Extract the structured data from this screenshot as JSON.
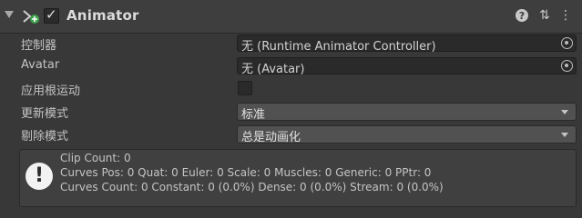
{
  "component": {
    "title": "Animator",
    "enabled_check": "✓",
    "help_glyph": "?",
    "presets_glyph": "⇅",
    "menu_glyph": "⋮"
  },
  "fields": {
    "controller": {
      "label": "控制器",
      "value": "无 (Runtime Animator Controller)"
    },
    "avatar": {
      "label": "Avatar",
      "value": "无 (Avatar)"
    },
    "apply_root_motion": {
      "label": "应用根运动",
      "checked": false
    },
    "update_mode": {
      "label": "更新模式",
      "value": "标准"
    },
    "culling_mode": {
      "label": "剔除模式",
      "value": "总是动画化"
    }
  },
  "info": {
    "icon_glyph": "!",
    "lines": [
      "Clip Count: 0",
      "Curves Pos: 0 Quat: 0 Euler: 0 Scale: 0 Muscles: 0 Generic: 0 PPtr: 0",
      "Curves Count: 0 Constant: 0 (0.0%) Dense: 0 (0.0%) Stream: 0 (0.0%)"
    ]
  }
}
